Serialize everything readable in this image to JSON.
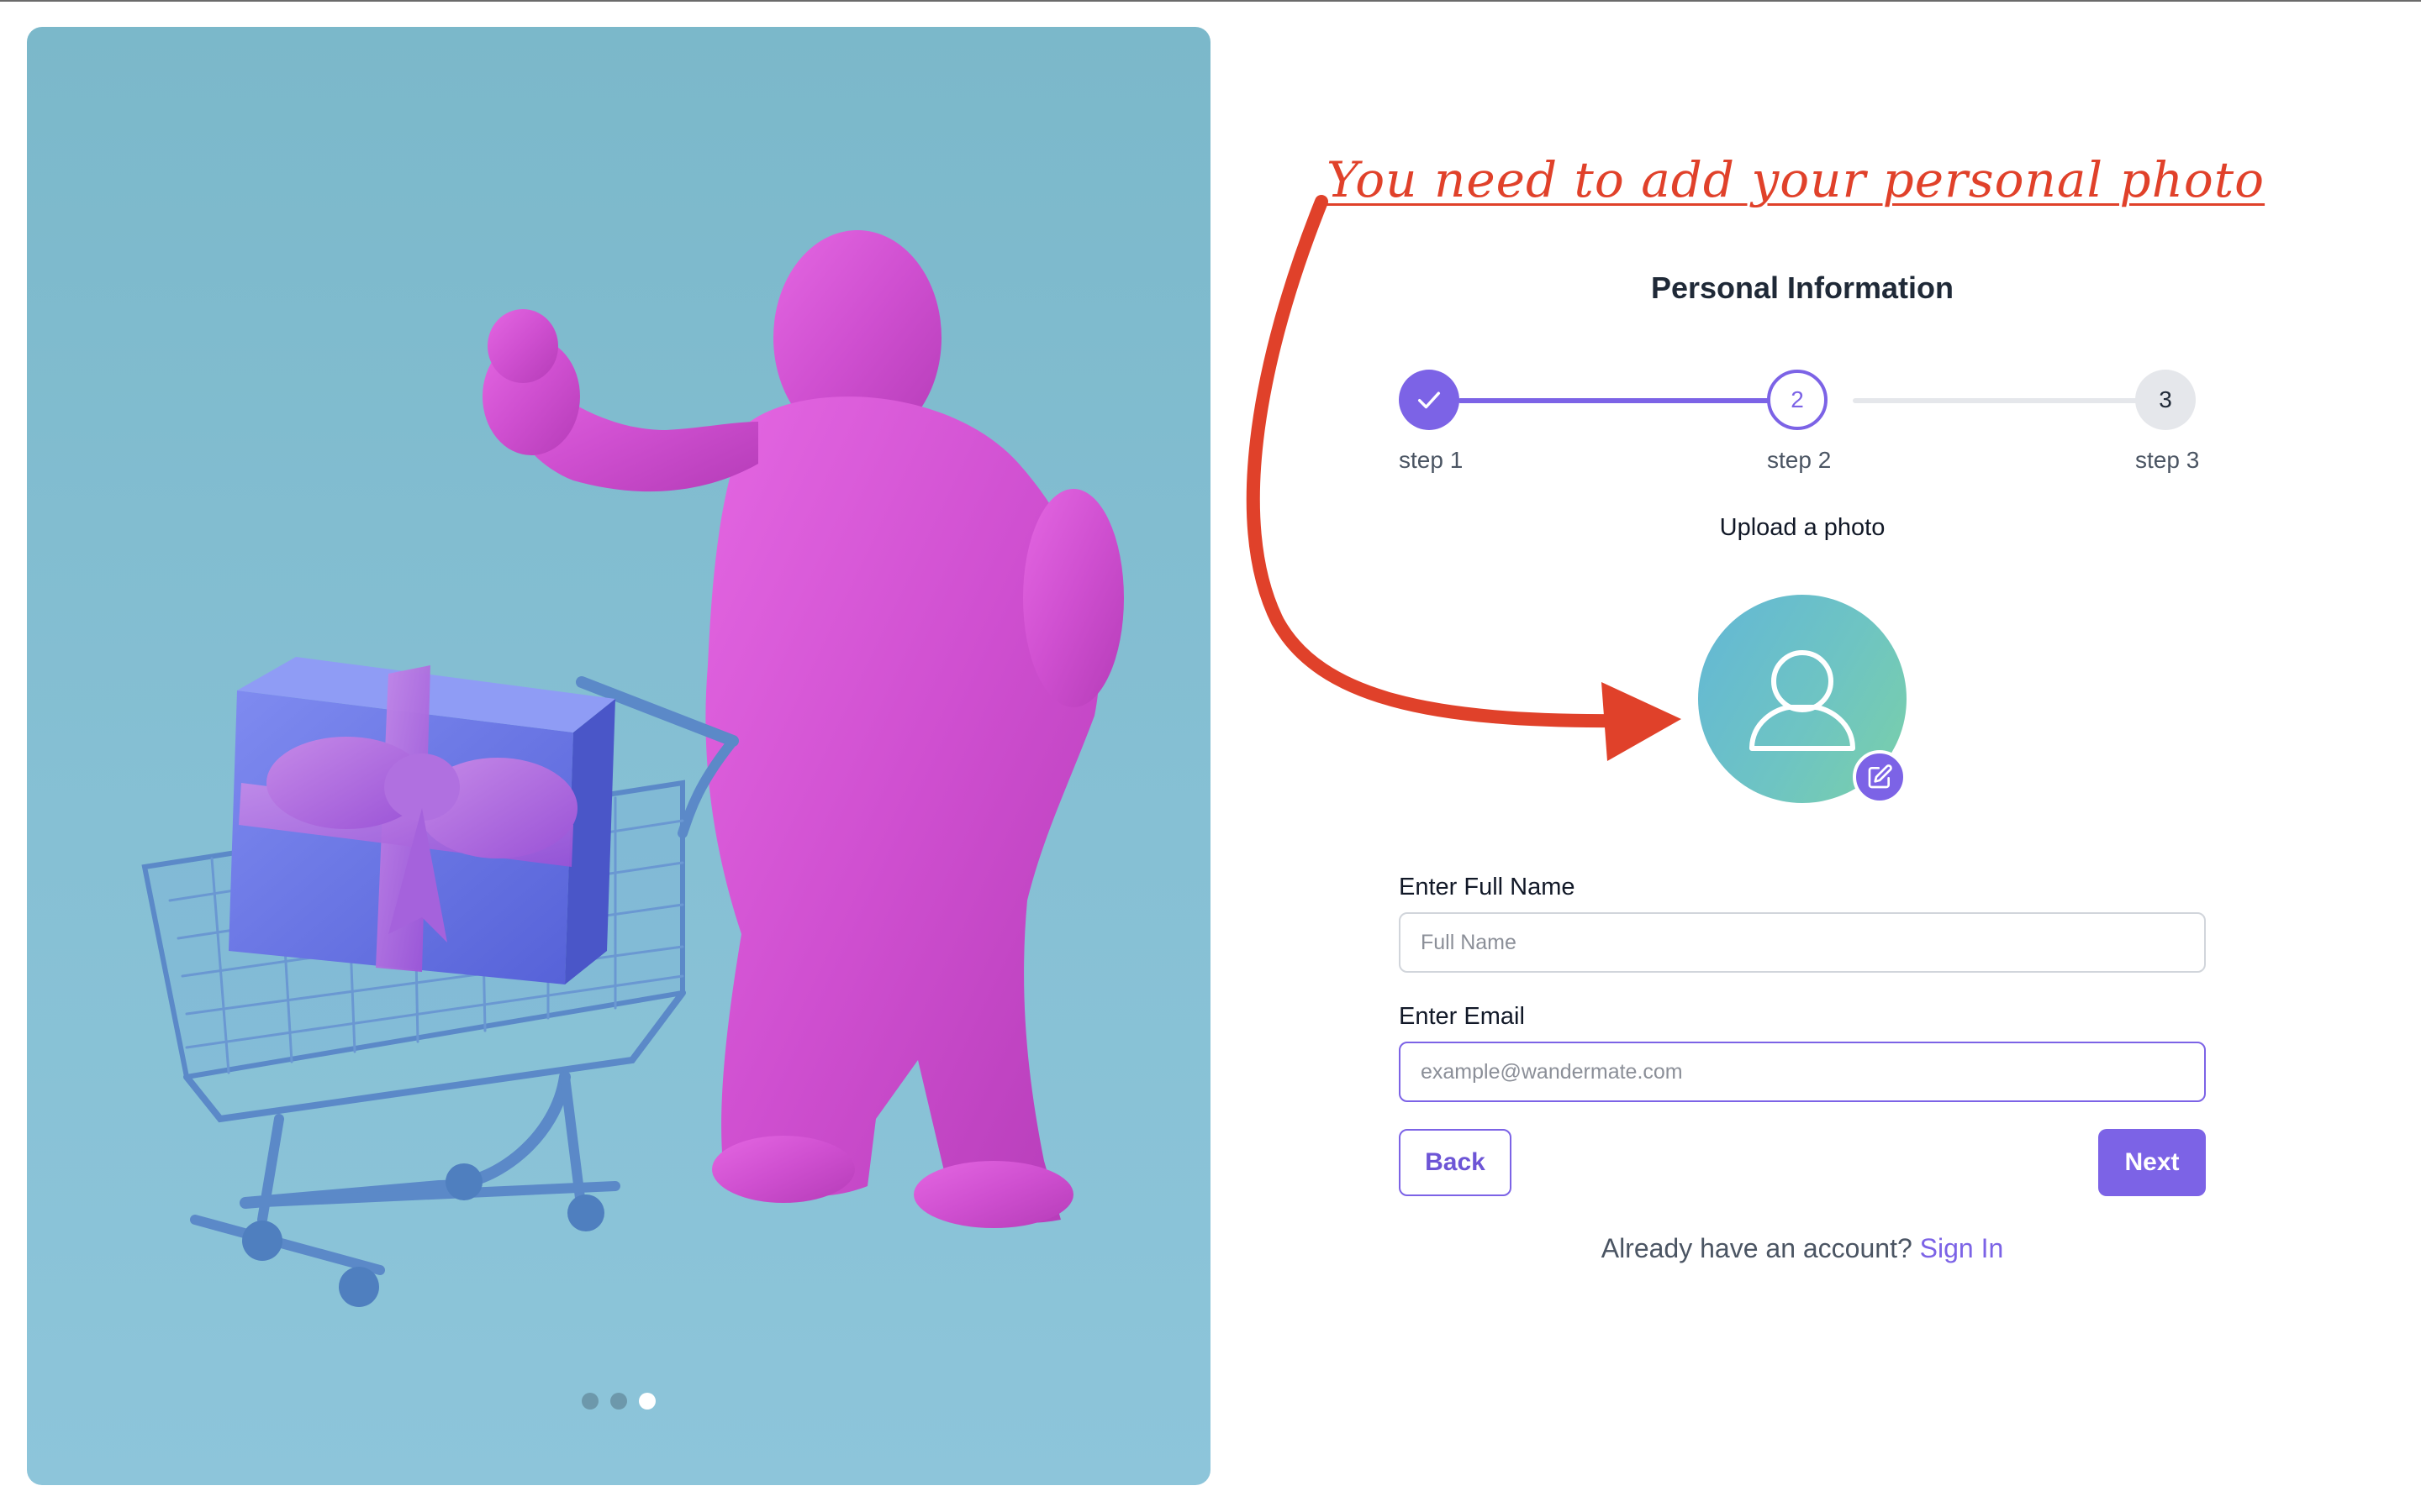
{
  "annotation": {
    "text": "You need to add your personal photo",
    "color": "#e0412a"
  },
  "hero": {
    "carousel": {
      "total": 3,
      "active_index": 3
    }
  },
  "form": {
    "title": "Personal Information",
    "steps": [
      {
        "number": "1",
        "label": "step 1",
        "state": "completed",
        "icon": "check-icon"
      },
      {
        "number": "2",
        "label": "step 2",
        "state": "current"
      },
      {
        "number": "3",
        "label": "step 3",
        "state": "upcoming"
      }
    ],
    "upload": {
      "label": "Upload a photo",
      "avatar_icon": "user-silhouette-icon",
      "edit_icon": "pencil-edit-icon"
    },
    "full_name": {
      "label": "Enter Full Name",
      "placeholder": "Full Name",
      "value": ""
    },
    "email": {
      "label": "Enter Email",
      "placeholder": "example@wandermate.com",
      "value": ""
    },
    "back_label": "Back",
    "next_label": "Next",
    "signin_prompt": "Already have an account?",
    "signin_link": "Sign In"
  },
  "colors": {
    "accent": "#7c63e6",
    "hero_background": "#86c0d4",
    "step_inactive": "#e5e7eb",
    "annotation": "#e0412a"
  }
}
